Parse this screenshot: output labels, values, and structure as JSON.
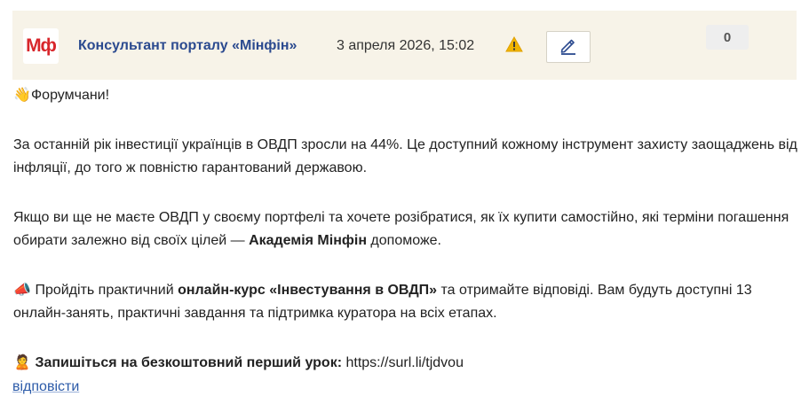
{
  "post": {
    "logo_text": "Мф",
    "author": "Консультант порталу «Мінфін»",
    "datetime": "3 апреля 2026, 15:02",
    "vote_count": "0",
    "icons": {
      "warning": "warning-icon",
      "edit": "pencil-icon"
    },
    "colors": {
      "header_bg": "#f7f3e8",
      "logo_red": "#d8262b",
      "author_blue": "#2b4a8f",
      "link_blue": "#2b5aa8"
    }
  },
  "content": {
    "p1_emoji": "👋",
    "p1_text": "Форумчани!",
    "p2_text": "За останній рік інвестиції українців в ОВДП зросли на 44%. Це доступний кожному інструмент захисту заощаджень від інфляції, до того ж повністю гарантований державою.",
    "p3_before": "Якщо ви ще не маєте ОВДП у своєму портфелі та хочете розібратися, як їх купити самостійно, які терміни погашення обирати залежно від своїх цілей — ",
    "p3_bold": "Академія Мінфін",
    "p3_after": " допоможе.",
    "p4_emoji": "📣",
    "p4_before": " Пройдіть практичний ",
    "p4_bold": "онлайн-курс «Інвестування в ОВДП»",
    "p4_after": " та отримайте відповіді. Вам будуть доступні 13 онлайн-занять, практичні завдання та підтримка куратора на всіх етапах.",
    "p5_emoji": "🙎",
    "p5_bold": " Запишіться на безкоштовний перший урок:",
    "p5_link": " https://surl.li/tjdvou"
  },
  "actions": {
    "reply_label": "відповісти"
  }
}
